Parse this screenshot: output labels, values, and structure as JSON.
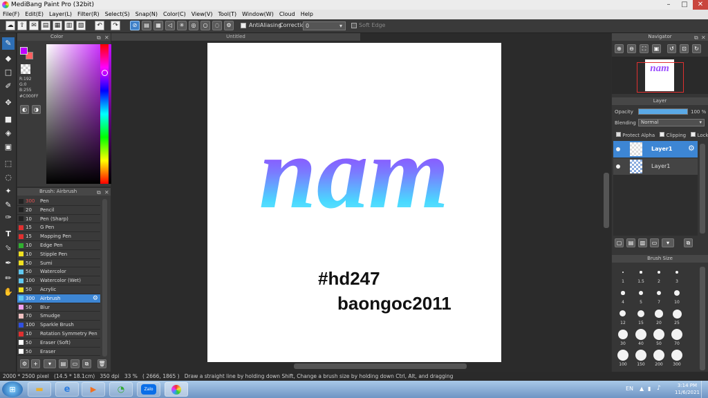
{
  "window": {
    "title": "MediBang Paint Pro (32bit)",
    "minimize": "–",
    "maximize": "□",
    "close": "✕"
  },
  "menu": [
    "File(F)",
    "Edit(E)",
    "Layer(L)",
    "Filter(R)",
    "Select(S)",
    "Snap(N)",
    "Color(C)",
    "View(V)",
    "Tool(T)",
    "Window(W)",
    "Cloud",
    "Help"
  ],
  "toolbar": {
    "antialiasing_label": "AntiAliasing",
    "correction_label": "Correction",
    "correction_value": "0",
    "soft_edge_label": "Soft Edge"
  },
  "color_panel": {
    "title": "Color",
    "r": "R:192",
    "g": "G:0",
    "b": "B:255",
    "hex": "#C000FF",
    "fg_color": "#c000ff",
    "bg_color": "#ff6060"
  },
  "brush_panel": {
    "title": "Brush: Airbrush",
    "items": [
      {
        "size": "300",
        "name": "Pen",
        "color": "#222222"
      },
      {
        "size": "20",
        "name": "Pencil",
        "color": "#222222"
      },
      {
        "size": "10",
        "name": "Pen (Sharp)",
        "color": "#222222"
      },
      {
        "size": "15",
        "name": "G Pen",
        "color": "#e03030"
      },
      {
        "size": "15",
        "name": "Mapping Pen",
        "color": "#e03030"
      },
      {
        "size": "10",
        "name": "Edge Pen",
        "color": "#30b030"
      },
      {
        "size": "10",
        "name": "Stipple Pen",
        "color": "#f0e020"
      },
      {
        "size": "50",
        "name": "Sumi",
        "color": "#f0e020"
      },
      {
        "size": "50",
        "name": "Watercolor",
        "color": "#60c8f0"
      },
      {
        "size": "100",
        "name": "Watercolor (Wet)",
        "color": "#60c8f0"
      },
      {
        "size": "50",
        "name": "Acrylic",
        "color": "#f0e020"
      },
      {
        "size": "300",
        "name": "Airbrush",
        "color": "#60c8f0"
      },
      {
        "size": "50",
        "name": "Blur",
        "color": "#f0a0f0"
      },
      {
        "size": "70",
        "name": "Smudge",
        "color": "#f0c0c0"
      },
      {
        "size": "100",
        "name": "Sparkle Brush",
        "color": "#3050e0"
      },
      {
        "size": "10",
        "name": "Rotation Symmetry Pen",
        "color": "#e03030"
      },
      {
        "size": "50",
        "name": "Eraser (Soft)",
        "color": "#ffffff"
      },
      {
        "size": "50",
        "name": "Eraser",
        "color": "#ffffff"
      }
    ]
  },
  "document": {
    "tab_title": "Untitled",
    "artwork_text": "nam",
    "hashtag": "#hd247",
    "author": "baongoc2011"
  },
  "navigator": {
    "title": "Navigator",
    "thumb_text": "nam"
  },
  "layer_panel": {
    "title": "Layer",
    "opacity_label": "Opacity",
    "opacity_value": "100 %",
    "opacity_fraction": 1.0,
    "blending_label": "Blending",
    "blending_value": "Normal",
    "protect_alpha": "Protect Alpha",
    "clipping": "Clipping",
    "lock": "Lock",
    "layers": [
      {
        "name": "Layer1",
        "selected": true
      },
      {
        "name": "Layer1",
        "selected": false
      }
    ]
  },
  "brush_size_panel": {
    "title": "Brush Size",
    "sizes": [
      "1",
      "1.5",
      "2",
      "3",
      "4",
      "5",
      "7",
      "10",
      "12",
      "15",
      "20",
      "25",
      "30",
      "40",
      "50",
      "70",
      "100",
      "150",
      "200",
      "300"
    ]
  },
  "status": {
    "image_size": "2000 * 2500 pixel",
    "physical_size": "(14.5 * 18.1cm)",
    "dpi": "350 dpi",
    "zoom": "33 %",
    "cursor": "( 2666, 1865 )",
    "hint": "Draw a straight line by holding down Shift, Change a brush size by holding down Ctrl, Alt, and dragging"
  },
  "taskbar": {
    "zalo_label": "Zalo",
    "language": "EN",
    "time": "3:14 PM",
    "date": "11/6/2021"
  }
}
